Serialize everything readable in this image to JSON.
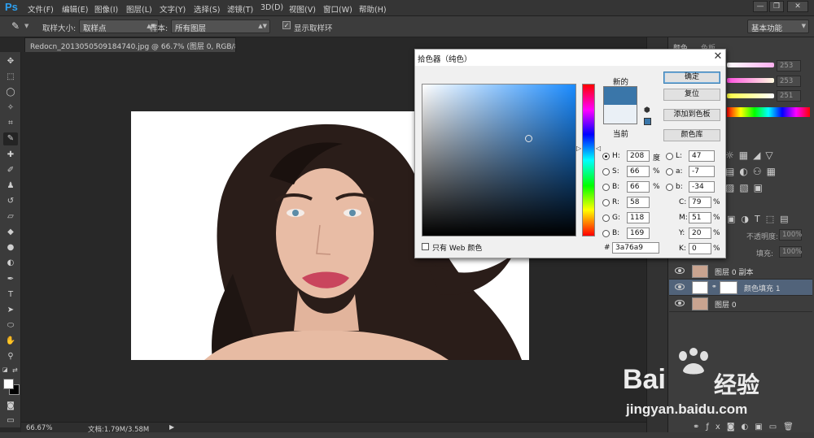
{
  "app": {
    "logo": "Ps"
  },
  "menubar": {
    "items": [
      "文件(F)",
      "编辑(E)",
      "图像(I)",
      "图层(L)",
      "文字(Y)",
      "选择(S)",
      "滤镜(T)",
      "3D(D)",
      "视图(V)",
      "窗口(W)",
      "帮助(H)"
    ],
    "window_buttons": [
      "—",
      "❐",
      "✕"
    ]
  },
  "options": {
    "sample_size_label": "取样大小:",
    "sample_size_value": "取样点",
    "sample_label": "样本:",
    "sample_value": "所有图层",
    "show_ring_label": "显示取样环",
    "workspace": "基本功能"
  },
  "document": {
    "tab_title": "Redocn_2013050509184740.jpg @ 66.7% (图层 0, RGB/8#) *",
    "tab_close": "×"
  },
  "status": {
    "zoom": "66.67%",
    "doc_info": "文档:1.79M/3.58M"
  },
  "color_picker": {
    "title": "拾色器（纯色）",
    "new_label": "新的",
    "current_label": "当前",
    "new_color": "#3a76a9",
    "current_color": "#eaf0f6",
    "buttons": {
      "ok": "确定",
      "reset": "复位",
      "add_to_swatches": "添加到色板",
      "color_libraries": "颜色库"
    },
    "only_web_colors": "只有 Web 颜色",
    "hsb": {
      "h_label": "H:",
      "h": "208",
      "h_unit": "度",
      "s_label": "S:",
      "s": "66",
      "s_unit": "%",
      "b_label": "B:",
      "b": "66",
      "b_unit": "%"
    },
    "rgb": {
      "r_label": "R:",
      "r": "58",
      "g_label": "G:",
      "g": "118",
      "b_label": "B:",
      "b": "169"
    },
    "lab": {
      "l_label": "L:",
      "l": "47",
      "a_label": "a:",
      "a": "-7",
      "b_label": "b:",
      "b": "-34"
    },
    "cmyk": {
      "c_label": "C:",
      "c": "79",
      "m_label": "M:",
      "m": "51",
      "y_label": "Y:",
      "y": "20",
      "k_label": "K:",
      "k": "0",
      "unit": "%"
    },
    "hex_label": "#",
    "hex": "3a76a9"
  },
  "panels": {
    "color_tab": "颜色",
    "swatch_tab": "色板",
    "slider_values": [
      "253",
      "253",
      "251"
    ],
    "opacity_label": "不透明度:",
    "opacity": "100%",
    "fill_label": "填充:",
    "fill": "100%"
  },
  "layers": [
    {
      "name": "图层 0 副本",
      "selected": false
    },
    {
      "name": "颜色填充 1",
      "selected": true
    },
    {
      "name": "图层 0",
      "selected": false
    }
  ],
  "watermark": {
    "brand": "Bai",
    "brand2": "经验",
    "url": "jingyan.baidu.com"
  }
}
